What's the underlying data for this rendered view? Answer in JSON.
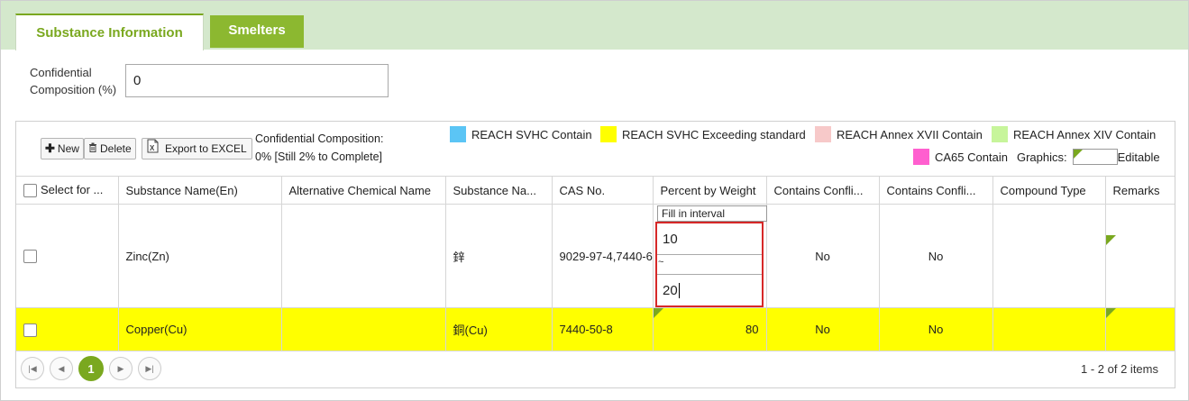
{
  "tabs": [
    {
      "label": "Substance Information",
      "active": true
    },
    {
      "label": "Smelters",
      "active": false
    }
  ],
  "confidential": {
    "label": "Confidential Composition (%)",
    "value": "0"
  },
  "toolbar": {
    "new_label": "New",
    "delete_label": "Delete",
    "export_label": "Export to EXCEL",
    "status_line1": "Confidential Composition:",
    "status_line2": "0% [Still 2% to Complete]"
  },
  "legend": {
    "svhc_contain": {
      "label": "REACH SVHC Contain",
      "color": "#5bc5f5"
    },
    "svhc_exceeding": {
      "label": "REACH SVHC Exceeding standard",
      "color": "#ffff00"
    },
    "annex17": {
      "label": "REACH Annex XVII Contain",
      "color": "#f7c9c9"
    },
    "annex14": {
      "label": "REACH Annex XIV Contain",
      "color": "#c7f59b"
    },
    "ca65": {
      "label": "CA65 Contain",
      "color": "#ff5fcf"
    },
    "graphics_label": "Graphics:",
    "editable_label": "Editable"
  },
  "columns": {
    "select": "Select for ...",
    "name_en": "Substance Name(En)",
    "alt_name": "Alternative Chemical Name",
    "name_local": "Substance Na...",
    "cas": "CAS No.",
    "percent": "Percent by Weight",
    "conflict1": "Contains Confli...",
    "conflict2": "Contains Confli...",
    "compound": "Compound Type",
    "remarks": "Remarks"
  },
  "rows": [
    {
      "name_en": "Zinc(Zn)",
      "alt_name": "",
      "name_local": "鋅",
      "cas": "9029-97-4,7440-6",
      "percent": "",
      "conflict1": "No",
      "conflict2": "No",
      "compound": "",
      "remarks": ""
    },
    {
      "name_en": "Copper(Cu)",
      "alt_name": "",
      "name_local": "銅(Cu)",
      "cas": "7440-50-8",
      "percent": "80",
      "conflict1": "No",
      "conflict2": "No",
      "compound": "",
      "remarks": ""
    }
  ],
  "interval_editor": {
    "hint": "Fill in interval",
    "low": "10",
    "separator": "~",
    "high": "20"
  },
  "pager": {
    "current_page": "1",
    "info": "1 - 2 of 2 items"
  }
}
